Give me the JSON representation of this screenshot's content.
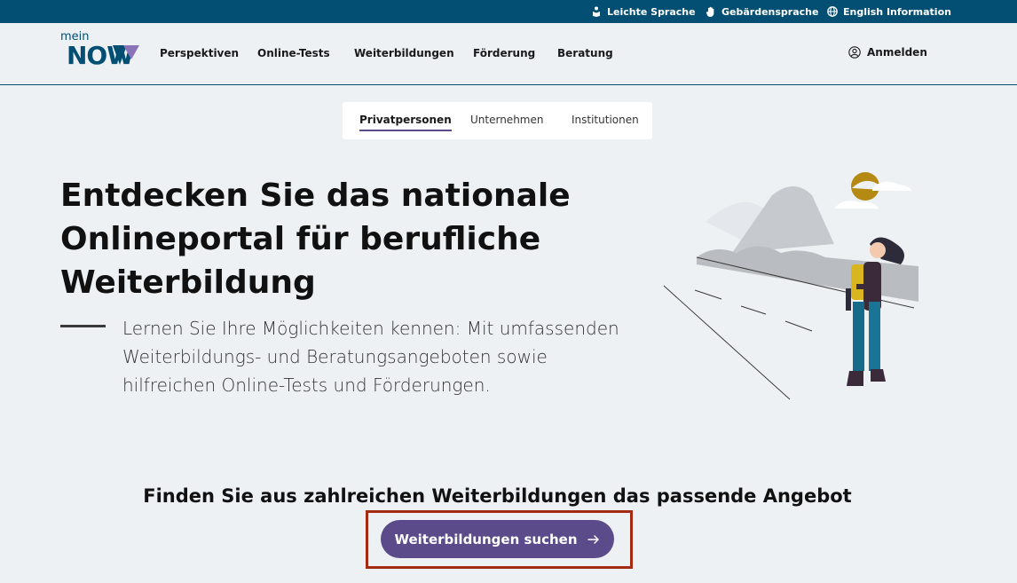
{
  "topbar": {
    "easy_language": "Leichte Sprache",
    "sign_language": "Gebärdensprache",
    "english": "English Information"
  },
  "logo": {
    "small": "mein",
    "big": "NOW"
  },
  "nav": {
    "items": [
      {
        "label": "Perspektiven"
      },
      {
        "label": "Online-Tests"
      },
      {
        "label": "Weiterbildungen"
      },
      {
        "label": "Förderung"
      },
      {
        "label": "Beratung"
      }
    ],
    "login": "Anmelden"
  },
  "tabs": {
    "items": [
      {
        "label": "Privatpersonen",
        "active": true
      },
      {
        "label": "Unternehmen",
        "active": false
      },
      {
        "label": "Institutionen",
        "active": false
      }
    ]
  },
  "hero": {
    "title": "Entdecken Sie das nationale Onlineportal für berufliche Weiterbildung",
    "text": "Lernen Sie Ihre Möglichkeiten kennen: Mit umfassenden Weiterbildungs- und Beratungsangeboten sowie hilfreichen Online-Tests und Förderungen."
  },
  "cta": {
    "heading": "Finden Sie aus zahlreichen Weiterbildungen das passende Angebot",
    "button": "Weiterbildungen suchen"
  },
  "icons": {
    "easy_language": "person-book-icon",
    "sign_language": "hand-icon",
    "english": "globe-icon",
    "login": "user-circle-icon",
    "cta": "arrow-right-icon"
  },
  "colors": {
    "topbar": "#024f73",
    "brand_blue": "#024f73",
    "accent_purple": "#5b4b8a",
    "highlight_red": "#a52a14",
    "background": "#eef1f4"
  }
}
